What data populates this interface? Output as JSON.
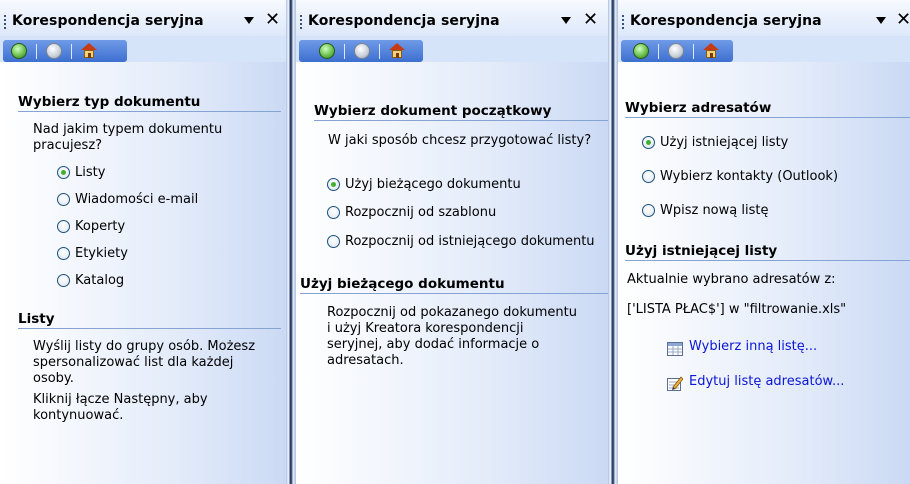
{
  "panels": [
    {
      "title": "Korespondencja seryjna",
      "section1_title": "Wybierz typ dokumentu",
      "question": "Nad jakim typem dokumentu pracujesz?",
      "options": [
        "Listy",
        "Wiadomości e-mail",
        "Koperty",
        "Etykiety",
        "Katalog"
      ],
      "selected": "Listy",
      "section2_title": "Listy",
      "description": "Wyślij listy do grupy osób. Możesz spersonalizować list dla każdej osoby.",
      "instruction": "Kliknij łącze Następny, aby kontynuować."
    },
    {
      "title": "Korespondencja seryjna",
      "section1_title": "Wybierz dokument początkowy",
      "question": "W jaki sposób chcesz przygotować listy?",
      "options": [
        "Użyj bieżącego dokumentu",
        "Rozpocznij od szablonu",
        "Rozpocznij od istniejącego dokumentu"
      ],
      "selected": "Użyj bieżącego dokumentu",
      "section2_title": "Użyj bieżącego dokumentu",
      "description": "Rozpocznij od pokazanego dokumentu i użyj Kreatora korespondencji seryjnej, aby dodać informacje o adresatach."
    },
    {
      "title": "Korespondencja seryjna",
      "section1_title": "Wybierz adresatów",
      "options": [
        "Użyj istniejącej listy",
        "Wybierz kontakty (Outlook)",
        "Wpisz nową listę"
      ],
      "selected": "Użyj istniejącej listy",
      "section2_title": "Użyj istniejącej listy",
      "current_label": "Aktualnie wybrano adresatów z:",
      "current_source": "['LISTA PŁAC$'] w \"filtrowanie.xls\"",
      "link1": "Wybierz inną listę...",
      "link2": "Edytuj listę adresatów..."
    }
  ],
  "icons": {
    "nav_back": "back-arrow-icon",
    "nav_forward": "forward-arrow-icon",
    "nav_home": "home-icon",
    "pane_menu": "dropdown-arrow-icon",
    "pane_close": "close-icon"
  },
  "colors": {
    "section_rule": "#87a3d3",
    "navbar": "#3d6fd0",
    "link": "#0a16d6",
    "radio_dot": "#3fb030"
  }
}
